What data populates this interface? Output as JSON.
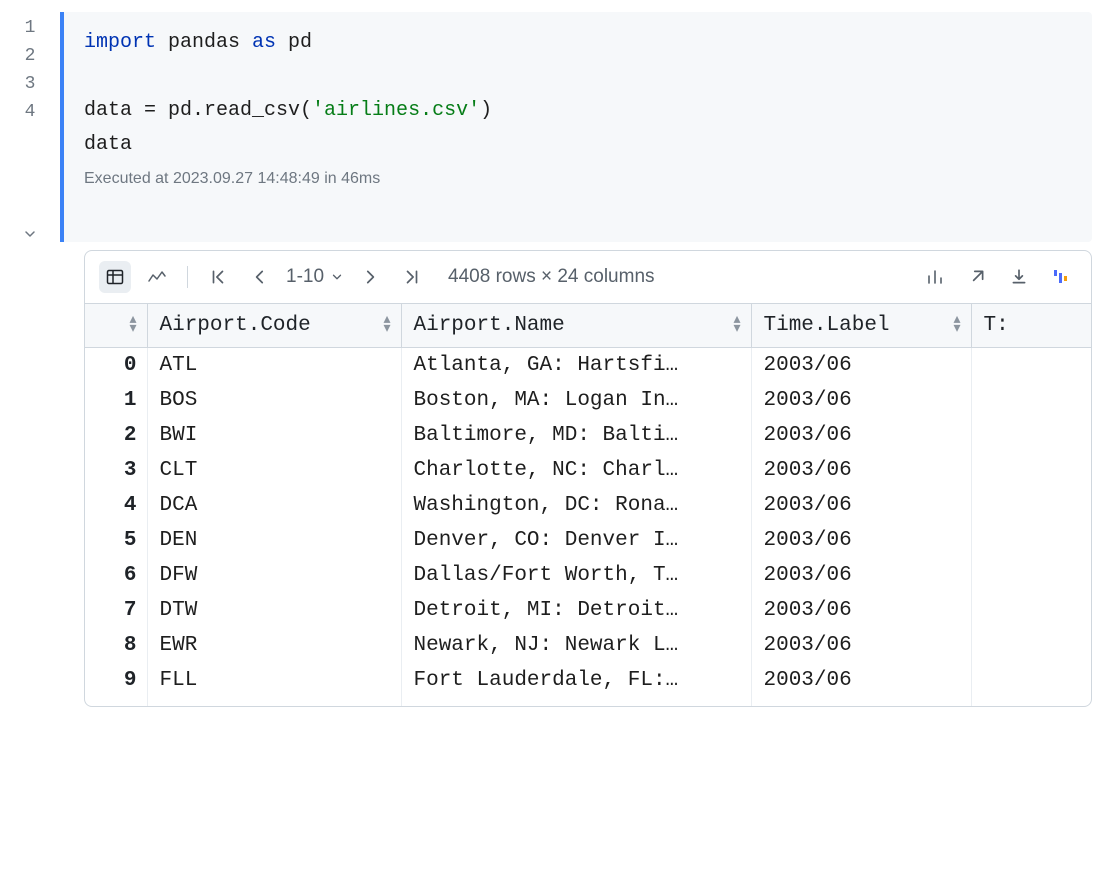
{
  "code": {
    "lines": [
      "1",
      "2",
      "3",
      "4"
    ],
    "l1k1": "import",
    "l1i1": " pandas ",
    "l1k2": "as",
    "l1i2": " pd",
    "l3": "data = pd.read_csv(",
    "l3s": "'airlines.csv'",
    "l3e": ")",
    "l4": "data",
    "status": "Executed at 2023.09.27 14:48:49 in 46ms"
  },
  "toolbar": {
    "range": "1-10",
    "summary": "4408 rows × 24 columns"
  },
  "table": {
    "headers": [
      "",
      "Airport.Code",
      "Airport.Name",
      "Time.Label",
      "T:"
    ],
    "rows": [
      {
        "idx": "0",
        "code": "ATL",
        "name": "Atlanta, GA: Hartsfi…",
        "time": "2003/06"
      },
      {
        "idx": "1",
        "code": "BOS",
        "name": "Boston, MA: Logan In…",
        "time": "2003/06"
      },
      {
        "idx": "2",
        "code": "BWI",
        "name": "Baltimore, MD: Balti…",
        "time": "2003/06"
      },
      {
        "idx": "3",
        "code": "CLT",
        "name": "Charlotte, NC: Charl…",
        "time": "2003/06"
      },
      {
        "idx": "4",
        "code": "DCA",
        "name": "Washington, DC: Rona…",
        "time": "2003/06"
      },
      {
        "idx": "5",
        "code": "DEN",
        "name": "Denver, CO: Denver I…",
        "time": "2003/06"
      },
      {
        "idx": "6",
        "code": "DFW",
        "name": "Dallas/Fort Worth, T…",
        "time": "2003/06"
      },
      {
        "idx": "7",
        "code": "DTW",
        "name": "Detroit, MI: Detroit…",
        "time": "2003/06"
      },
      {
        "idx": "8",
        "code": "EWR",
        "name": "Newark, NJ: Newark L…",
        "time": "2003/06"
      },
      {
        "idx": "9",
        "code": "FLL",
        "name": "Fort Lauderdale, FL:…",
        "time": "2003/06"
      }
    ]
  }
}
